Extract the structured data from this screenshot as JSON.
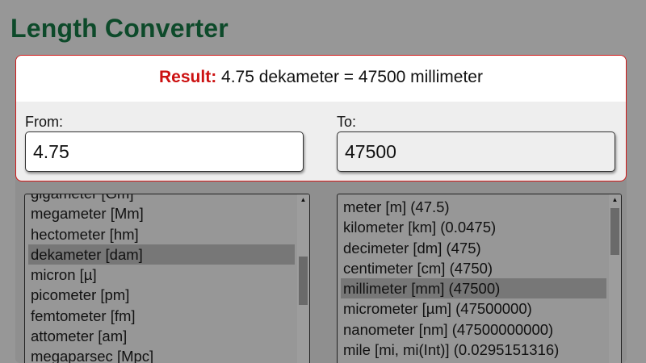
{
  "title": "Length Converter",
  "result": {
    "label": "Result:",
    "text": "4.75 dekameter = 47500 millimeter"
  },
  "from": {
    "label": "From:",
    "value": "4.75"
  },
  "to": {
    "label": "To:",
    "value": "47500"
  },
  "from_units": [
    "gigameter [Gm]",
    "megameter [Mm]",
    "hectometer [hm]",
    "dekameter [dam]",
    "micron [µ]",
    "picometer [pm]",
    "femtometer [fm]",
    "attometer [am]",
    "megaparsec [Mpc]"
  ],
  "from_selected": "dekameter [dam]",
  "to_units": [
    "meter [m] (47.5)",
    "kilometer [km] (0.0475)",
    "decimeter [dm] (475)",
    "centimeter [cm] (4750)",
    "millimeter [mm] (47500)",
    "micrometer [µm] (47500000)",
    "nanometer [nm] (47500000000)",
    "mile [mi, mi(Int)] (0.0295151316)"
  ],
  "to_selected": "millimeter [mm] (47500)",
  "icons": {
    "scroll_up": "triangle-up",
    "scroll_down": "triangle-down"
  },
  "colors": {
    "title": "#0d4a2a",
    "result_label": "#cc1111",
    "panel_border": "#d01818",
    "selected_row": "#777777"
  }
}
